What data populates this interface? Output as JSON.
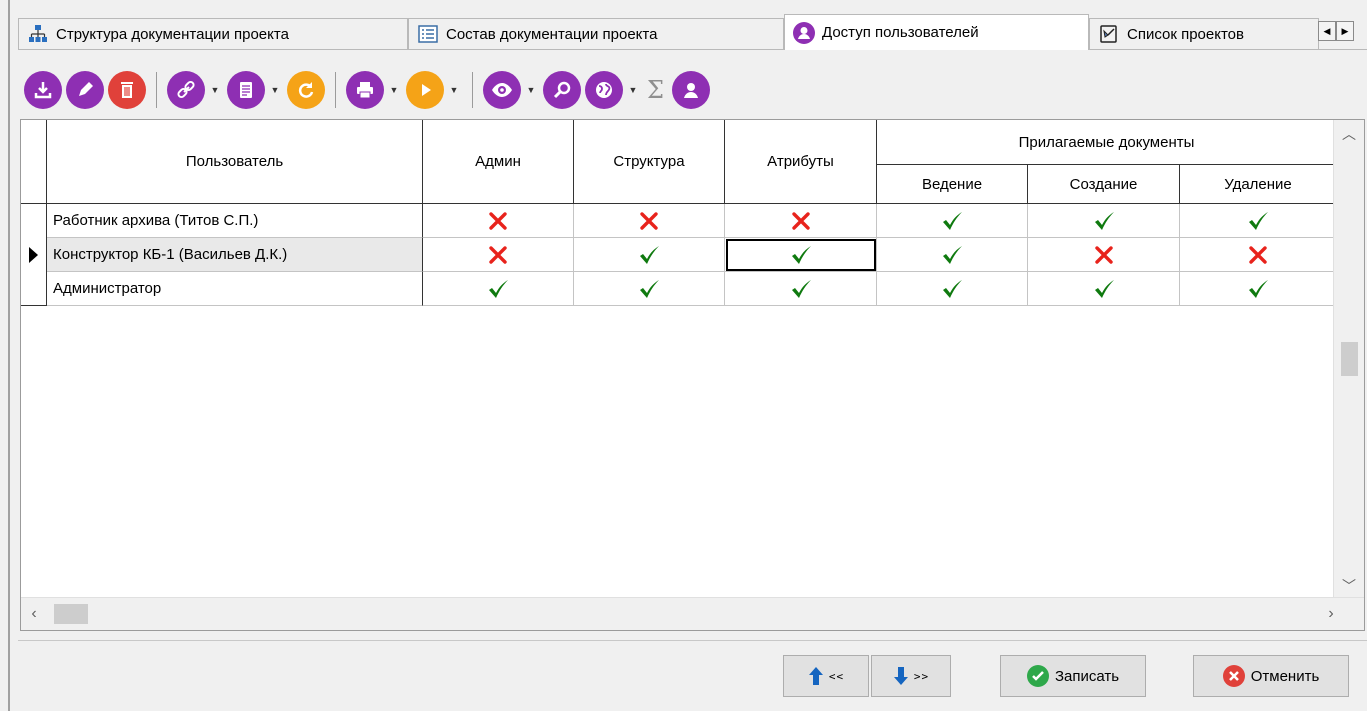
{
  "tabs": [
    {
      "label": "Структура документации проекта",
      "icon": "hierarchy-icon",
      "active": false
    },
    {
      "label": "Состав документации проекта",
      "icon": "list-icon",
      "active": false
    },
    {
      "label": "Доступ пользователей",
      "icon": "user-icon",
      "active": true
    },
    {
      "label": "Список проектов",
      "icon": "projects-book-icon",
      "active": false
    }
  ],
  "toolbar": {
    "icons": [
      "download-icon",
      "edit-icon",
      "delete-icon",
      "link-icon",
      "document-icon",
      "refresh-icon",
      "print-icon",
      "play-icon",
      "view-icon",
      "search-icon",
      "globe-icon",
      "sigma-icon",
      "user-icon"
    ],
    "sigma": "Σ"
  },
  "table": {
    "headers": {
      "user": "Пользователь",
      "admin": "Админ",
      "structure": "Структура",
      "attributes": "Атрибуты",
      "docs_group": "Прилагаемые документы",
      "maintain": "Ведение",
      "create": "Создание",
      "remove": "Удаление"
    },
    "rows": [
      {
        "user": "Работник архива (Титов С.П.)",
        "admin": false,
        "structure": false,
        "attributes": false,
        "maintain": true,
        "create": true,
        "remove": true,
        "selected": false
      },
      {
        "user": "Конструктор КБ-1 (Васильев Д.К.)",
        "admin": false,
        "structure": true,
        "attributes": true,
        "maintain": true,
        "create": false,
        "remove": false,
        "selected": true
      },
      {
        "user": "Администратор",
        "admin": true,
        "structure": true,
        "attributes": true,
        "maintain": true,
        "create": true,
        "remove": true,
        "selected": false
      }
    ]
  },
  "nav": {
    "prev": "<<",
    "next": ">>"
  },
  "buttons": {
    "save": "Записать",
    "cancel": "Отменить"
  },
  "colors": {
    "check": "#0f7a0f",
    "cross": "#e8231c",
    "accent": "#8e2fb3"
  }
}
